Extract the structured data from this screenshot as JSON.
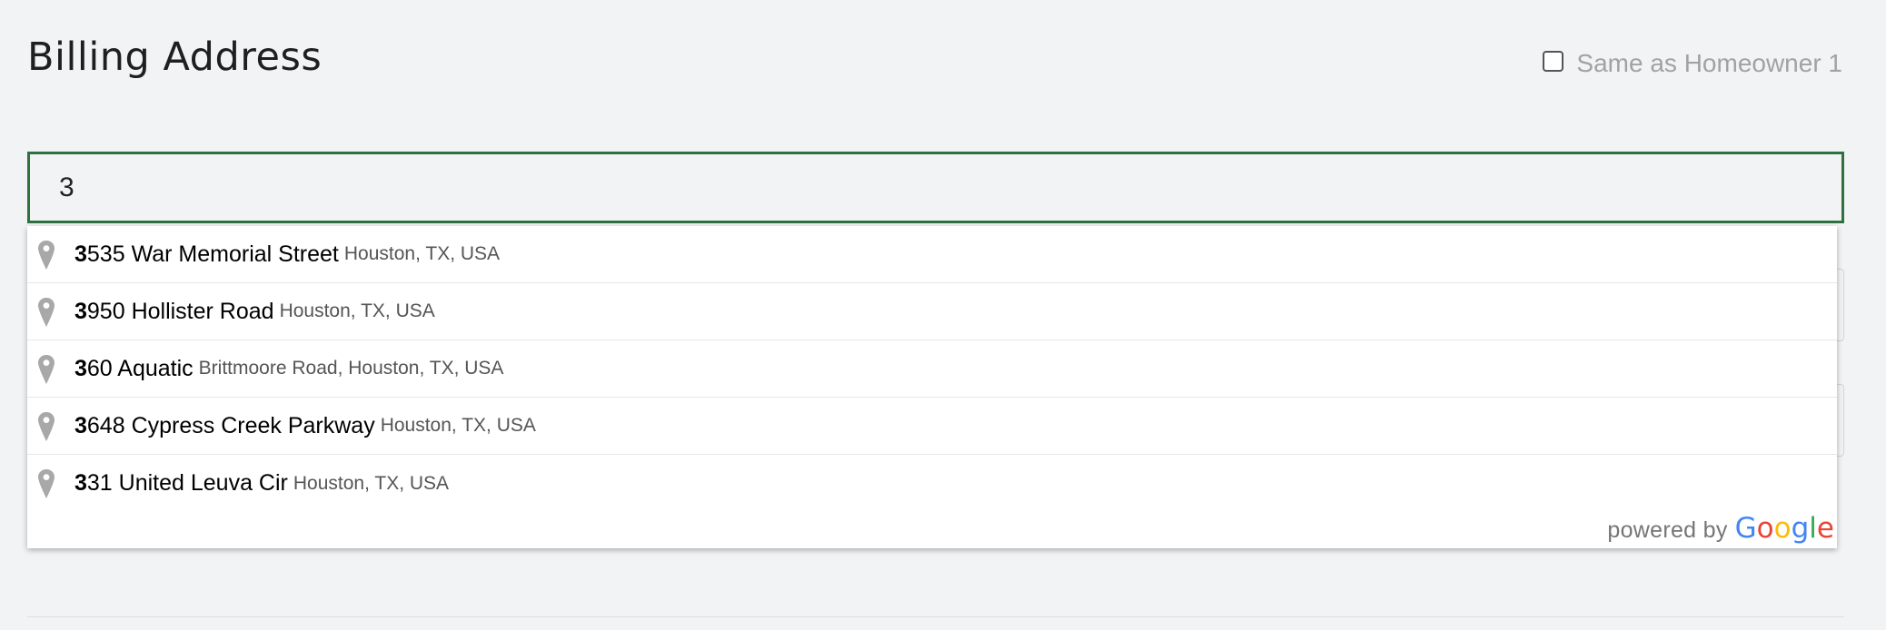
{
  "section": {
    "title": "Billing Address",
    "same_as_label": "Same as Homeowner 1",
    "same_as_checked": false
  },
  "address_input": {
    "value": "3"
  },
  "suggestions": [
    {
      "match": "3",
      "main_rest": "535 War Memorial Street",
      "secondary": "Houston, TX, USA"
    },
    {
      "match": "3",
      "main_rest": "950 Hollister Road",
      "secondary": "Houston, TX, USA"
    },
    {
      "match": "3",
      "main_rest": "60 Aquatic",
      "secondary": "Brittmoore Road, Houston, TX, USA"
    },
    {
      "match": "3",
      "main_rest": "648 Cypress Creek Parkway",
      "secondary": "Houston, TX, USA"
    },
    {
      "match": "3",
      "main_rest": "31 United Leuva Cir",
      "secondary": "Houston, TX, USA"
    }
  ],
  "attribution": {
    "powered_by": "powered by",
    "brand_letters": [
      "G",
      "o",
      "o",
      "g",
      "l",
      "e"
    ]
  },
  "icons": {
    "suggestion_icon": "map-pin-icon"
  },
  "colors": {
    "input_border": "#2e7240",
    "pin": "#a8a8a8",
    "muted_text": "#a2a2a2"
  }
}
